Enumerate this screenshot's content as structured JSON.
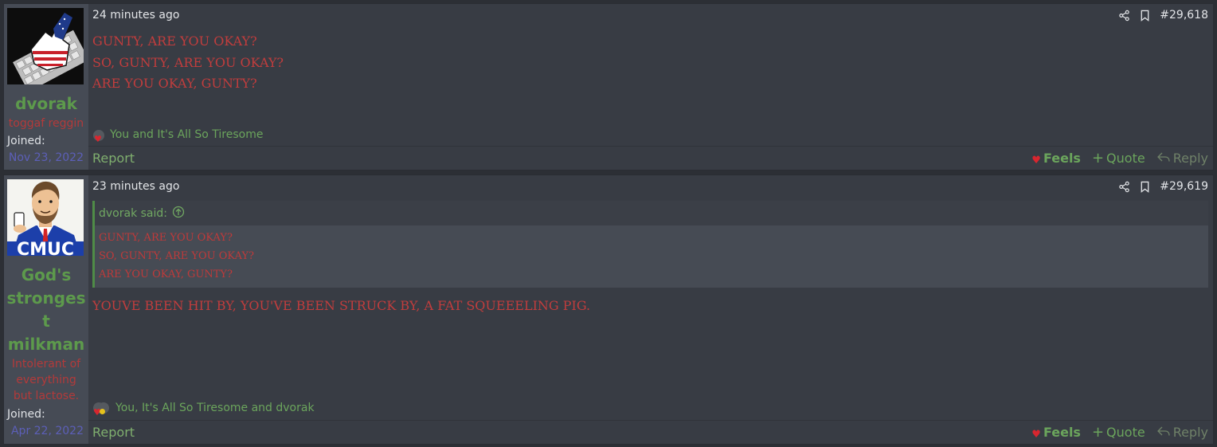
{
  "posts": [
    {
      "author": "dvorak",
      "user_title": "toggaf reggin",
      "joined_label": "Joined:",
      "joined_date": "Nov 23, 2022",
      "time": "24 minutes ago",
      "post_number": "#29,618",
      "lines": [
        "GUNTY, ARE YOU OKAY?",
        "SO, GUNTY, ARE YOU OKAY?",
        "ARE YOU OKAY, GUNTY?"
      ],
      "reactions_text": "You and It's All So Tiresome",
      "report_label": "Report",
      "feels_label": "Feels",
      "quote_label": "Quote",
      "reply_label": "Reply"
    },
    {
      "author_lines": [
        "God's",
        "stronges",
        "t",
        "milkman"
      ],
      "user_title_lines": [
        "Intolerant of",
        "everything",
        "but lactose."
      ],
      "joined_label": "Joined:",
      "joined_date": "Apr 22, 2022",
      "time": "23 minutes ago",
      "post_number": "#29,619",
      "quote_author": "dvorak said:",
      "quote_lines": [
        "GUNTY, ARE YOU OKAY?",
        "SO, GUNTY, ARE YOU OKAY?",
        "ARE YOU OKAY, GUNTY?"
      ],
      "line": "YOUVE BEEN HIT BY, YOU'VE BEEN STRUCK BY, A FAT SQUEEELING PIG.",
      "reactions_text": "You, It's All So Tiresome and dvorak",
      "report_label": "Report",
      "feels_label": "Feels",
      "quote_label": "Quote",
      "reply_label": "Reply"
    }
  ],
  "icons": {
    "share": "share-icon",
    "bookmark": "bookmark-icon",
    "heart": "heart-icon",
    "plus": "plus-icon",
    "reply": "reply-icon",
    "arrow_up_circle": "arrow-up-circle-icon"
  },
  "colors": {
    "username": "#5d9a4c",
    "post_text": "#c13d3d",
    "joined_date": "#5c5fb8",
    "action_green": "#6ba55c"
  }
}
